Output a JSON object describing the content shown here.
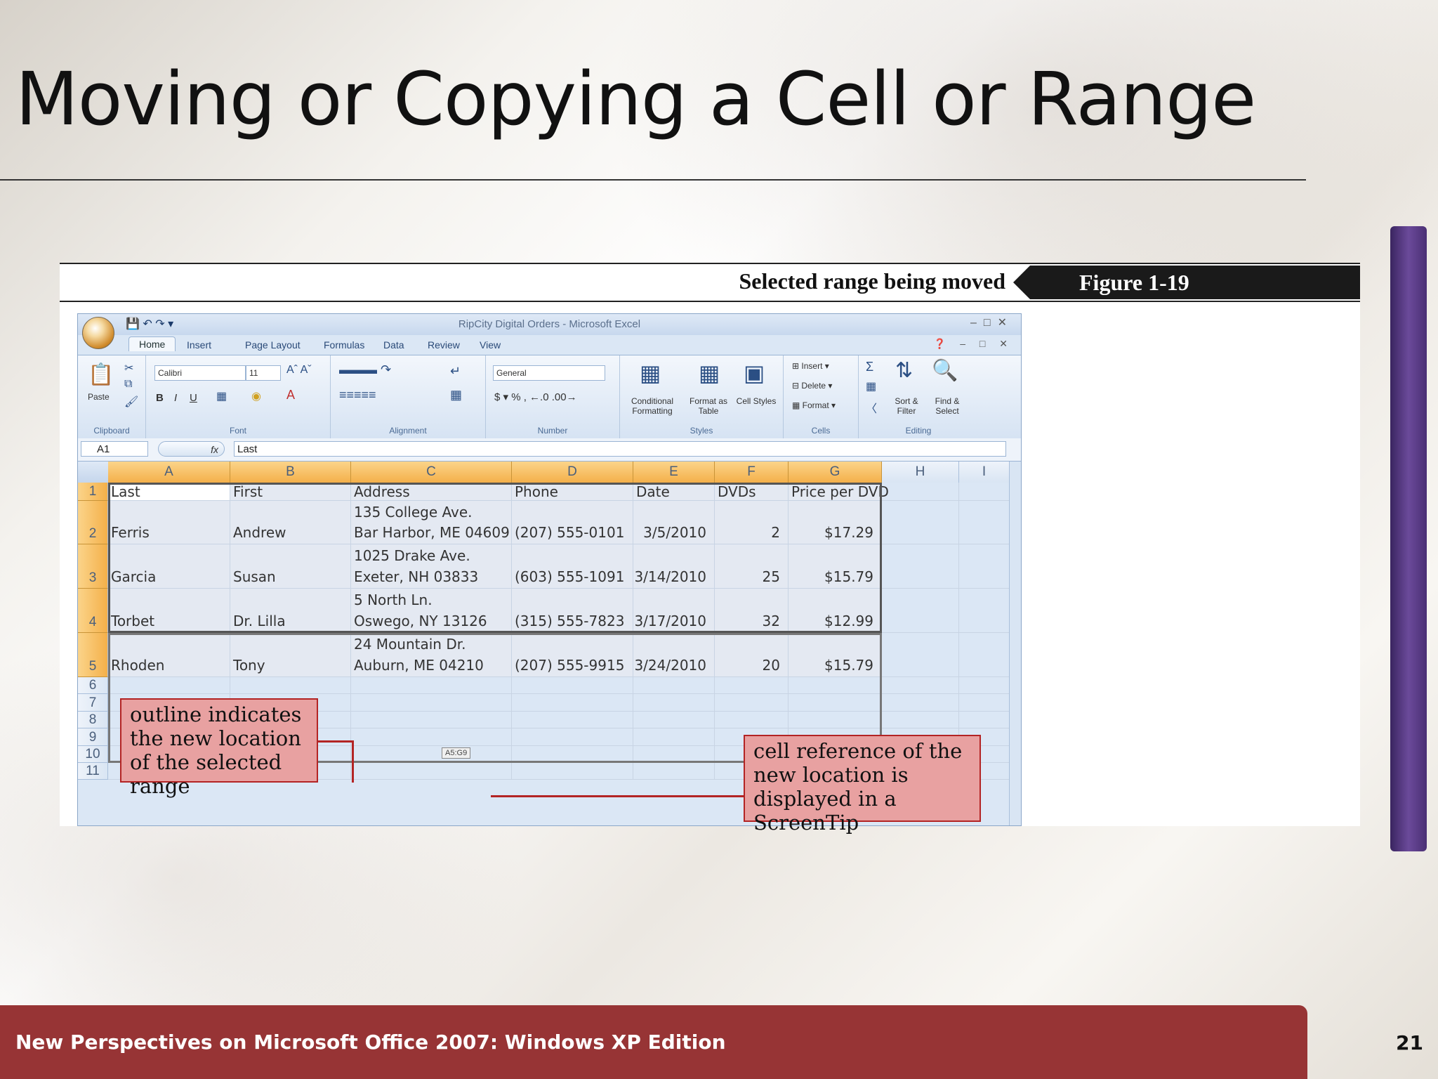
{
  "slide": {
    "title": "Moving or Copying a Cell or Range",
    "footer": "New Perspectives on Microsoft Office 2007: Windows XP Edition",
    "page_number": "21"
  },
  "figure": {
    "caption": "Selected range being moved",
    "label": "Figure  1-19"
  },
  "excel": {
    "window_title": "RipCity Digital Orders - Microsoft Excel",
    "tabs": [
      "Home",
      "Insert",
      "Page Layout",
      "Formulas",
      "Data",
      "Review",
      "View"
    ],
    "ribbon": {
      "paste": "Paste",
      "font_name": "Calibri",
      "font_size": "11",
      "number_format": "General",
      "conditional_formatting": "Conditional Formatting",
      "format_as_table": "Format as Table",
      "cell_styles": "Cell Styles",
      "insert": "Insert",
      "delete": "Delete",
      "format": "Format",
      "sort_filter": "Sort & Filter",
      "find_select": "Find & Select",
      "groups": [
        "Clipboard",
        "Font",
        "Alignment",
        "Number",
        "Styles",
        "Cells",
        "Editing"
      ]
    },
    "name_box": "A1",
    "fx": "fx",
    "formula_value": "Last",
    "columns": [
      "A",
      "B",
      "C",
      "D",
      "E",
      "F",
      "G",
      "H",
      "I"
    ],
    "row_numbers": [
      "1",
      "2",
      "3",
      "4",
      "5",
      "6",
      "7",
      "8",
      "9",
      "10",
      "11"
    ],
    "headers": [
      "Last",
      "First",
      "Address",
      "Phone",
      "Date",
      "DVDs",
      "Price per DVD"
    ],
    "rows": [
      {
        "last": "Ferris",
        "first": "Andrew",
        "addr1": "135 College Ave.",
        "addr2": "Bar Harbor, ME 04609",
        "phone": "(207) 555-0101",
        "date": "3/5/2010",
        "dvds": "2",
        "price": "$17.29"
      },
      {
        "last": "Garcia",
        "first": "Susan",
        "addr1": "1025 Drake Ave.",
        "addr2": "Exeter, NH 03833",
        "phone": "(603) 555-1091",
        "date": "3/14/2010",
        "dvds": "25",
        "price": "$15.79"
      },
      {
        "last": "Torbet",
        "first": "Dr. Lilla",
        "addr1": "5 North Ln.",
        "addr2": "Oswego, NY 13126",
        "phone": "(315) 555-7823",
        "date": "3/17/2010",
        "dvds": "32",
        "price": "$12.99"
      },
      {
        "last": "Rhoden",
        "first": "Tony",
        "addr1": "24 Mountain Dr.",
        "addr2": "Auburn, ME 04210",
        "phone": "(207) 555-9915",
        "date": "3/24/2010",
        "dvds": "20",
        "price": "$15.79"
      }
    ],
    "screentip": "A5:G9"
  },
  "callouts": {
    "left": "outline indicates the new location of the selected range",
    "right": "cell reference of the new location is displayed in a ScreenTip"
  }
}
